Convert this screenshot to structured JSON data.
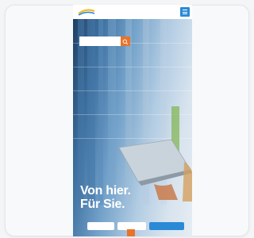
{
  "hero": {
    "headline_line1": "Von hier.",
    "headline_line2": "Für Sie."
  },
  "search": {
    "placeholder": ""
  },
  "buttons": {
    "first": "",
    "second": "",
    "third": ""
  },
  "colors": {
    "accent": "#e8742a",
    "primary": "#2a8ad6"
  },
  "icons": {
    "menu": "hamburger-icon",
    "search": "search-icon",
    "logo": "company-logo"
  }
}
